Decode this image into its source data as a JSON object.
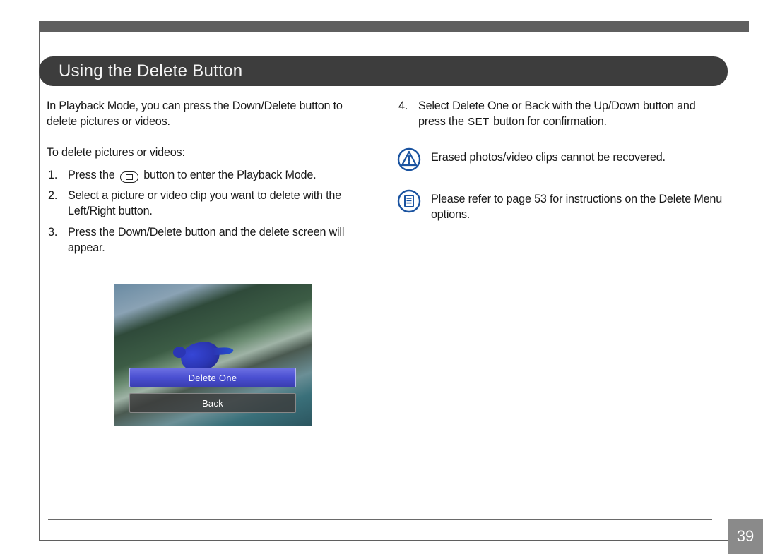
{
  "section_title": "Using the Delete Button",
  "left": {
    "intro": "In Playback Mode, you can press the Down/Delete button to delete pictures or videos.",
    "subhead": "To delete pictures or videos:",
    "steps": [
      {
        "pre": "Press the ",
        "post": " button to enter the Playback Mode."
      },
      {
        "text": "Select a picture or video clip you want to delete with the Left/Right button."
      },
      {
        "text": "Press the Down/Delete button and the delete screen will appear."
      }
    ]
  },
  "right": {
    "steps": [
      {
        "pre": "Select Delete One or Back with the Up/Down button and press the ",
        "set_label": "SET",
        "post": " button for confirmation."
      }
    ],
    "warn": "Erased photos/video clips cannot be recovered.",
    "note": "Please refer to page 53 for instructions on the Delete Menu options."
  },
  "screenshot_menu": {
    "selected": "Delete One",
    "other": "Back"
  },
  "page_number": "39"
}
